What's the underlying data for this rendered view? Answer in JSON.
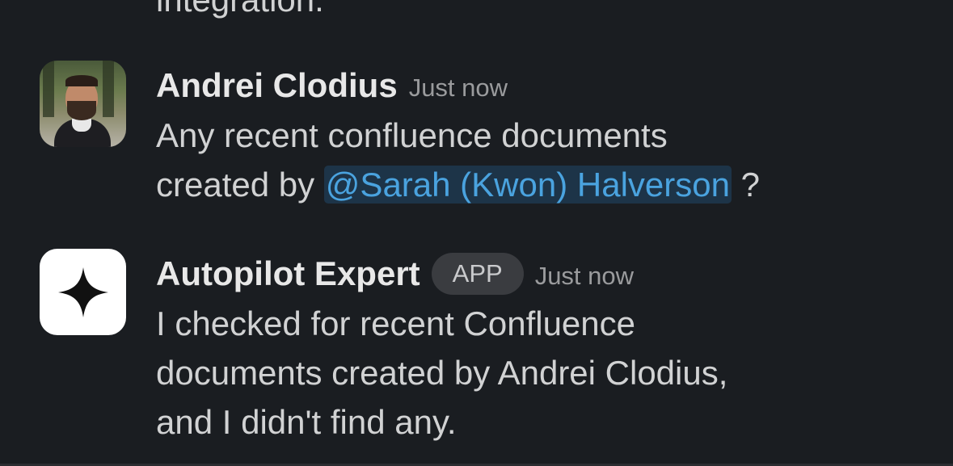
{
  "previous_message": {
    "text_fragment": "integration."
  },
  "messages": [
    {
      "author": "Andrei Clodius",
      "timestamp": "Just now",
      "avatar": "user-photo-avatar",
      "text_line1": "Any recent confluence documents",
      "text_line2_prefix": "created by ",
      "mention": "@Sarah (Kwon) Halverson",
      "text_line2_suffix": " ?"
    },
    {
      "author": "Autopilot Expert",
      "badge": "APP",
      "timestamp": "Just now",
      "avatar": "four-point-star-icon",
      "text_lines": [
        "I checked for recent Confluence",
        "documents created by Andrei Clodius,",
        "and I didn't find any."
      ]
    }
  ],
  "colors": {
    "background": "#1a1d21",
    "text": "#d1d2d3",
    "mention_text": "#4aa3df",
    "mention_bg": "#1d3448",
    "badge_bg": "#3a3c40",
    "timestamp": "#9a9b9d"
  }
}
